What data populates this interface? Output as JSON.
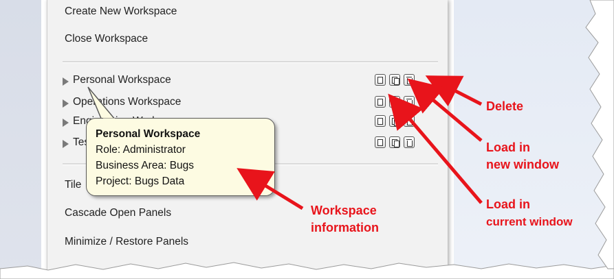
{
  "menu": {
    "create_new_workspace": "Create New Workspace",
    "close_workspace": "Close Workspace",
    "tile_partial": "Tile",
    "cascade_open_panels": "Cascade Open Panels",
    "minimize_restore_panels": "Minimize / Restore Panels"
  },
  "workspaces": [
    {
      "name": "Personal Workspace"
    },
    {
      "name": "Operations Workspace"
    },
    {
      "name": "Engineering Workspace"
    },
    {
      "name": "Test Workspace"
    }
  ],
  "tooltip": {
    "title": "Personal Workspace",
    "role": "Role: Administrator",
    "business_area": "Business Area: Bugs",
    "project": "Project: Bugs Data"
  },
  "callouts": {
    "delete": "Delete",
    "load_new_line1": "Load in",
    "load_new_line2": "new window",
    "load_current_line1": "Load in",
    "load_current_line2": "current window",
    "workspace_info_line1": "Workspace",
    "workspace_info_line2": "information"
  },
  "colors": {
    "callout": "#e8141b",
    "tooltip_bg": "#fdfbe2",
    "panel_bg": "#f2f2f2"
  }
}
